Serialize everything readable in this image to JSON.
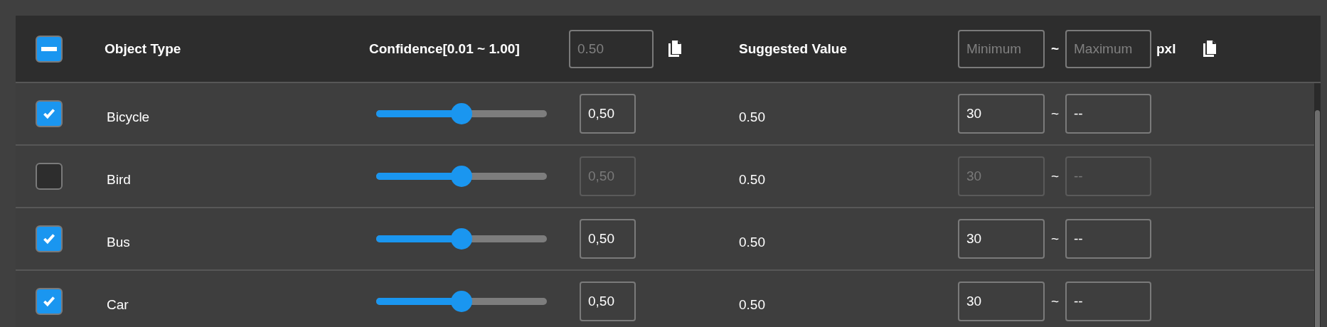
{
  "header": {
    "select_all": {
      "indeterminate": true
    },
    "object_type": "Object Type",
    "confidence": "Confidence[0.01 ~ 1.00]",
    "confidence_input": {
      "placeholder": "0.50"
    },
    "suggested": "Suggested Value",
    "min_input": {
      "placeholder": "Minimum"
    },
    "separator": "~",
    "max_input": {
      "placeholder": "Maximum"
    },
    "unit": "pxl"
  },
  "rows": [
    {
      "name": "Bicycle",
      "checked": true,
      "level": 0.5,
      "confidence": "0,50",
      "suggested": "0.50",
      "min": "30",
      "separator": "~",
      "max": "--"
    },
    {
      "name": "Bird",
      "checked": false,
      "level": 0.5,
      "confidence": "0,50",
      "suggested": "0.50",
      "min": "30",
      "separator": "~",
      "max": "--"
    },
    {
      "name": "Bus",
      "checked": true,
      "level": 0.5,
      "confidence": "0,50",
      "suggested": "0.50",
      "min": "30",
      "separator": "~",
      "max": "--"
    },
    {
      "name": "Car",
      "checked": true,
      "level": 0.5,
      "confidence": "0,50",
      "suggested": "0.50",
      "min": "30",
      "separator": "~",
      "max": "--"
    }
  ]
}
